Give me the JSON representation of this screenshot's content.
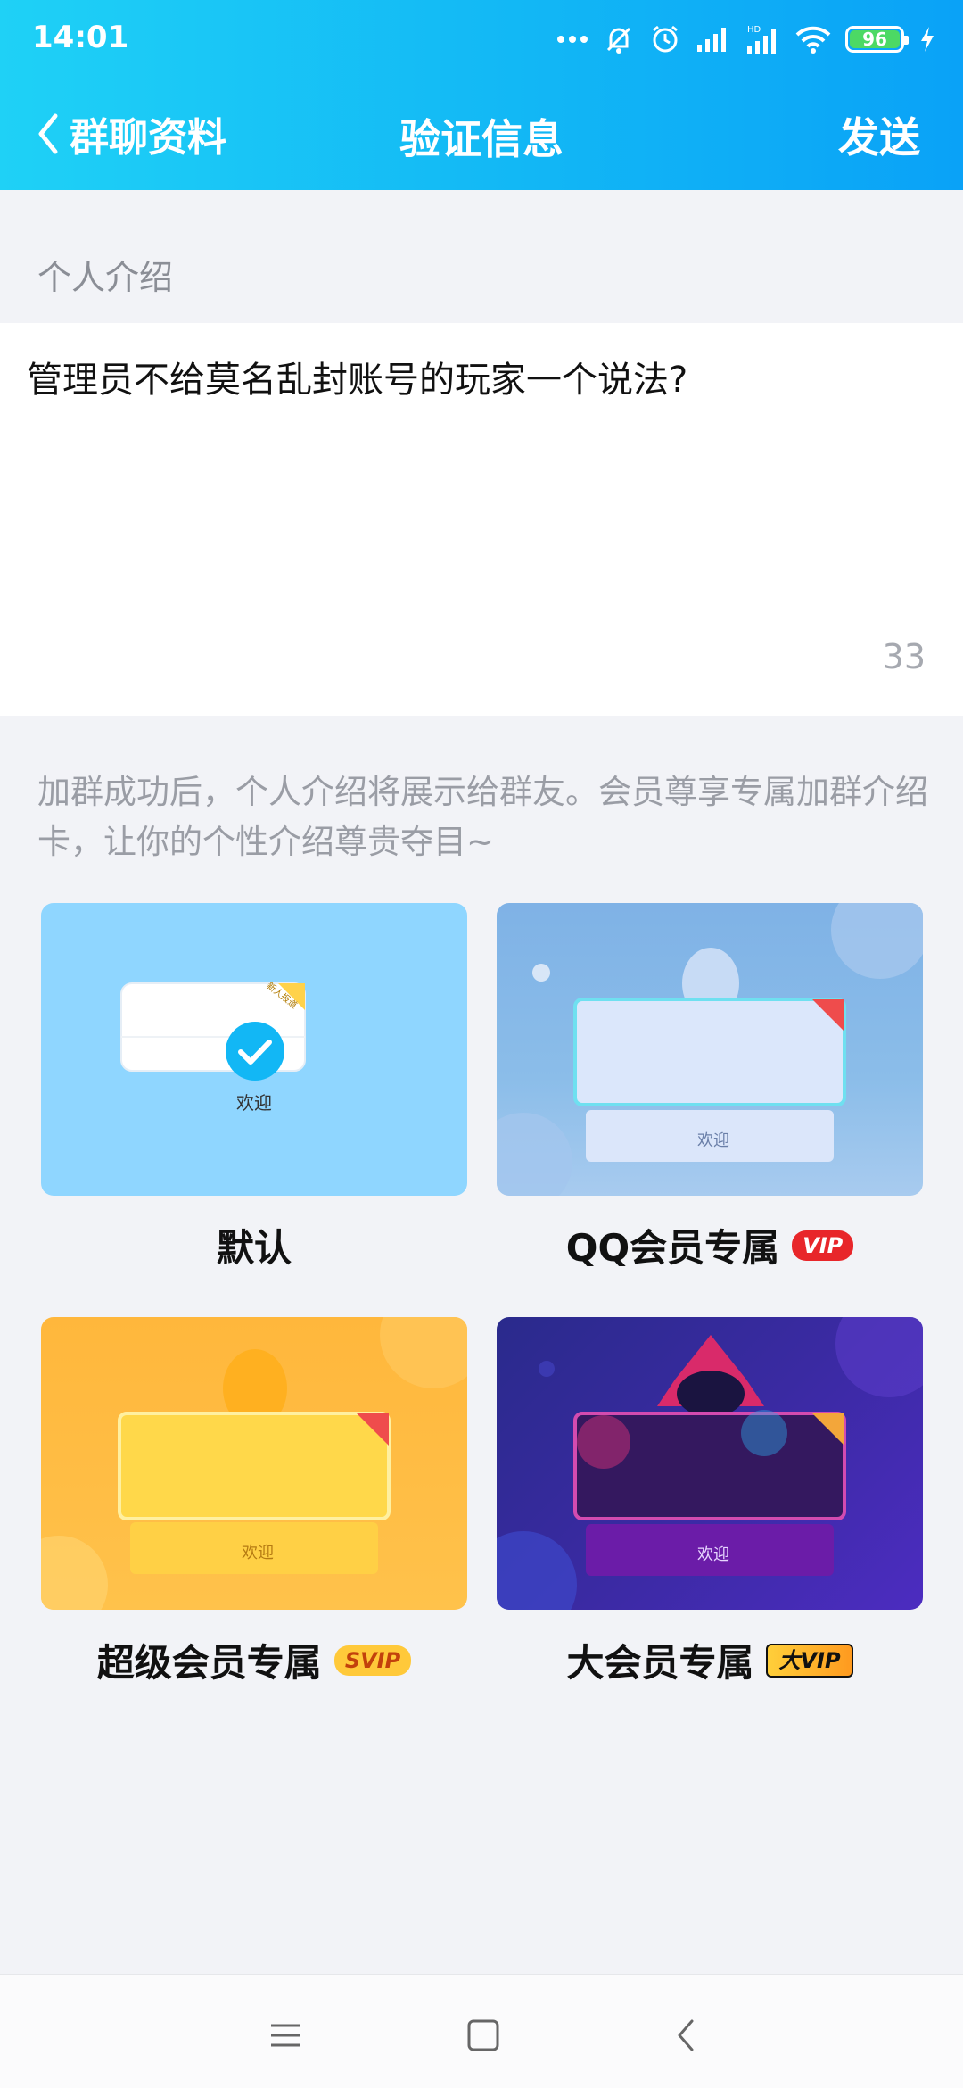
{
  "status_bar": {
    "time": "14:01",
    "battery": "96"
  },
  "navbar": {
    "back_label": "群聊资料",
    "title": "验证信息",
    "send_label": "发送"
  },
  "section_label": "个人介绍",
  "intro": {
    "text": "管理员不给莫名乱封账号的玩家一个说法?",
    "char_count": "33"
  },
  "hint": "加群成功后，个人介绍将展示给群友。会员尊享专属加群介绍卡，让你的个性介绍尊贵夺目~",
  "cards": [
    {
      "label": "默认",
      "preview_text": "欢迎",
      "selected": true
    },
    {
      "label": "QQ会员专属",
      "preview_text": "欢迎",
      "badge": "VIP"
    },
    {
      "label": "超级会员专属",
      "preview_text": "欢迎",
      "badge": "SVIP"
    },
    {
      "label": "大会员专属",
      "preview_text": "欢迎",
      "badge": "大VIP"
    }
  ],
  "ribbon_text": "新人报道",
  "colors": {
    "header_start": "#1fd1f6",
    "header_end": "#0aa2f7",
    "check": "#12b7f5"
  }
}
